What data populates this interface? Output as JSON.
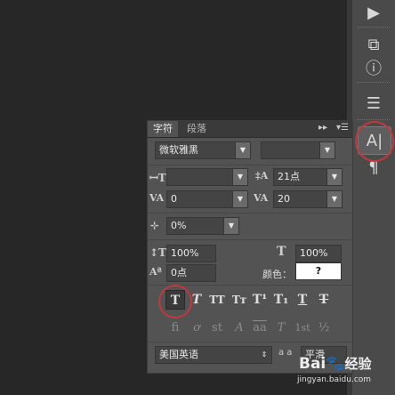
{
  "tabs": {
    "character": "字符",
    "paragraph": "段落"
  },
  "panel_controls": {
    "collapse": "▸▸",
    "menu": "▾☰"
  },
  "font": {
    "family": "微软雅黑",
    "style": ""
  },
  "size": {
    "font_size": "",
    "leading": "21点"
  },
  "spacing": {
    "kerning": "0",
    "tracking": "20"
  },
  "scale": {
    "tsume": "0%",
    "vertical": "100%",
    "horizontal": "100%"
  },
  "baseline": {
    "shift": "0点",
    "color_label": "颜色：",
    "color_value": "?"
  },
  "language": {
    "selected": "美国英语",
    "aa_label": "a a",
    "antialias": "平滑"
  },
  "style_buttons": [
    "T",
    "T",
    "TT",
    "Tт",
    "T¹",
    "T₁",
    "T",
    "T"
  ],
  "feature_buttons": [
    "fi",
    "ơ",
    "st",
    "A",
    "aa",
    "T",
    "1st",
    "½"
  ],
  "watermark": {
    "brand": "Bai",
    "brand_suffix": "经验",
    "url": "jingyan.baidu.com"
  },
  "colors": {
    "panel": "#535353",
    "tabbar": "#3a3a3a",
    "highlight": "#c0393f"
  }
}
